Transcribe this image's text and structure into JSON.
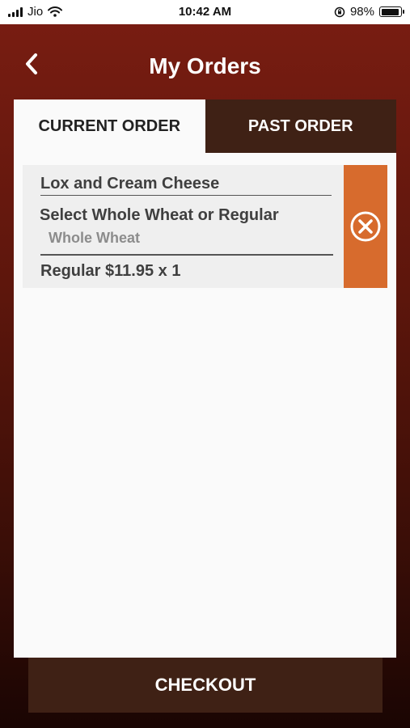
{
  "status_bar": {
    "carrier": "Jio",
    "time": "10:42 AM",
    "battery_percent": "98%",
    "battery_level": 0.98
  },
  "header": {
    "title": "My Orders",
    "back_icon": "chevron-left-icon"
  },
  "tabs": [
    {
      "label": "CURRENT ORDER",
      "active": true
    },
    {
      "label": "PAST ORDER",
      "active": false
    }
  ],
  "order": {
    "item_name": "Lox and Cream Cheese",
    "option_label": "Select Whole Wheat or Regular",
    "option_value": "Whole Wheat",
    "price_line": "Regular $11.95 x 1",
    "remove_icon": "close-circle-icon"
  },
  "checkout": {
    "label": "CHECKOUT"
  },
  "colors": {
    "accent_orange": "#d76b2d",
    "dark_brown": "#3f2115",
    "background_red": "#7a1d12"
  }
}
